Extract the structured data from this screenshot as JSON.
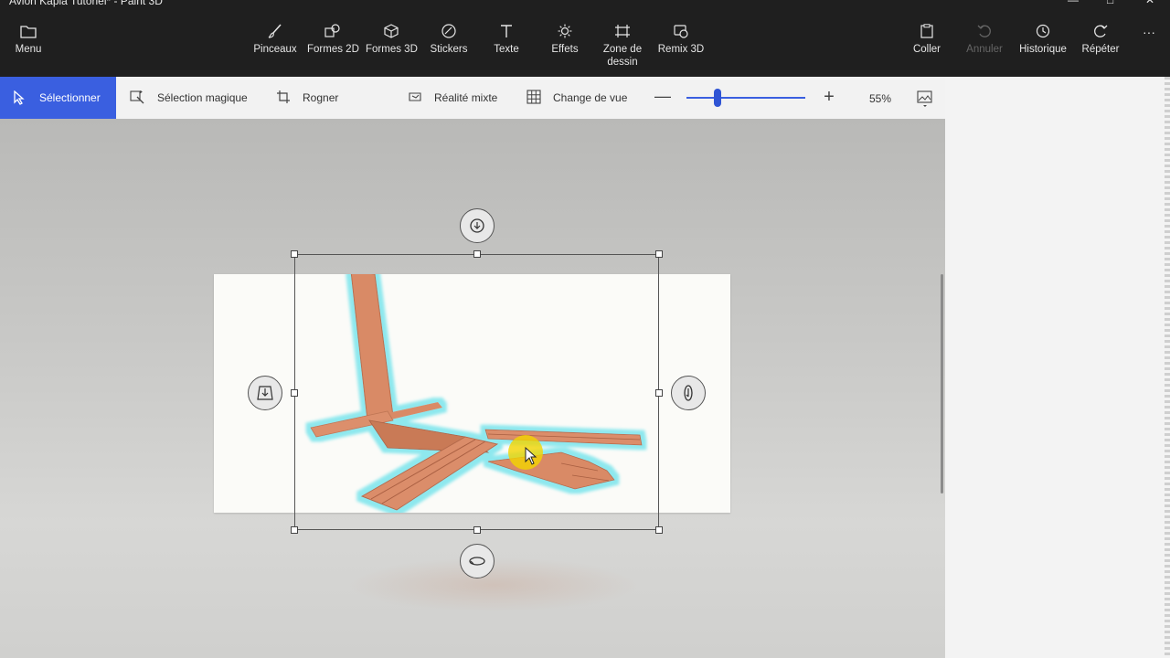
{
  "window": {
    "title": "Avion Kapla Tutoriel* - Paint 3D"
  },
  "toolbar": {
    "menu": "Menu",
    "tools": [
      "Pinceaux",
      "Formes 2D",
      "Formes 3D",
      "Stickers",
      "Texte",
      "Effets",
      "Zone de dessin",
      "Remix 3D"
    ],
    "coller": "Coller",
    "annuler": "Annuler",
    "historique": "Historique",
    "repeter": "Répéter",
    "more": "···"
  },
  "subbar": {
    "select": "Sélectionner",
    "magic": "Sélection magique",
    "crop": "Rogner",
    "mixed": "Réalité mixte",
    "view": "Change de vue",
    "zoom_percent": "55%",
    "zoom_minus": "—",
    "zoom_plus": "+"
  },
  "colors": {
    "accent": "#3a5fe0",
    "wood": "#d98a66",
    "glow": "#8ee8ee",
    "cursor_highlight": "#f2d400"
  }
}
